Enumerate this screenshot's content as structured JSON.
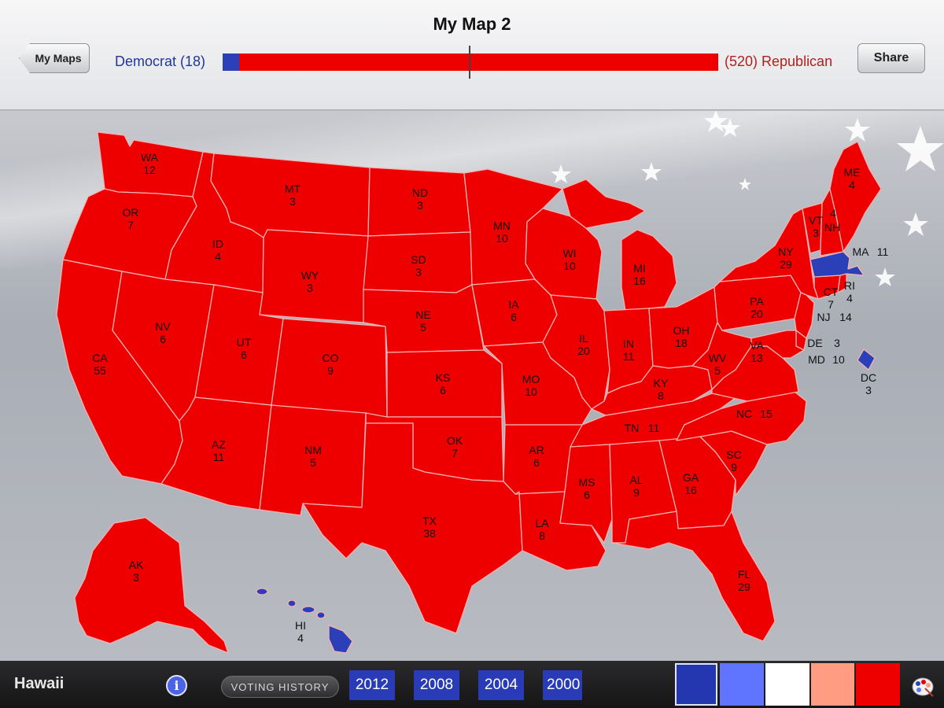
{
  "header": {
    "title": "My Map 2",
    "back_label": "My Maps",
    "share_label": "Share",
    "dem_label": "Democrat (18)",
    "rep_label": "(520) Republican",
    "dem_votes": 18,
    "rep_votes": 520
  },
  "colors": {
    "republican": "#ee0000",
    "democrat": "#2b3fb8",
    "map_border": "#f4b2b2"
  },
  "map": {
    "states": [
      {
        "abbr": "WA",
        "votes": "12"
      },
      {
        "abbr": "OR",
        "votes": "7"
      },
      {
        "abbr": "CA",
        "votes": "55"
      },
      {
        "abbr": "ID",
        "votes": "4"
      },
      {
        "abbr": "NV",
        "votes": "6"
      },
      {
        "abbr": "MT",
        "votes": "3"
      },
      {
        "abbr": "WY",
        "votes": "3"
      },
      {
        "abbr": "UT",
        "votes": "6"
      },
      {
        "abbr": "AZ",
        "votes": "11"
      },
      {
        "abbr": "CO",
        "votes": "9"
      },
      {
        "abbr": "NM",
        "votes": "5"
      },
      {
        "abbr": "ND",
        "votes": "3"
      },
      {
        "abbr": "SD",
        "votes": "3"
      },
      {
        "abbr": "NE",
        "votes": "5"
      },
      {
        "abbr": "KS",
        "votes": "6"
      },
      {
        "abbr": "OK",
        "votes": "7"
      },
      {
        "abbr": "TX",
        "votes": "38"
      },
      {
        "abbr": "MN",
        "votes": "10"
      },
      {
        "abbr": "IA",
        "votes": "6"
      },
      {
        "abbr": "MO",
        "votes": "10"
      },
      {
        "abbr": "AR",
        "votes": "6"
      },
      {
        "abbr": "LA",
        "votes": "8"
      },
      {
        "abbr": "WI",
        "votes": "10"
      },
      {
        "abbr": "IL",
        "votes": "20"
      },
      {
        "abbr": "MI",
        "votes": "16"
      },
      {
        "abbr": "IN",
        "votes": "11"
      },
      {
        "abbr": "OH",
        "votes": "18"
      },
      {
        "abbr": "KY",
        "votes": "8"
      },
      {
        "abbr": "TN",
        "votes": "11"
      },
      {
        "abbr": "MS",
        "votes": "6"
      },
      {
        "abbr": "AL",
        "votes": "9"
      },
      {
        "abbr": "GA",
        "votes": "16"
      },
      {
        "abbr": "FL",
        "votes": "29"
      },
      {
        "abbr": "SC",
        "votes": "9"
      },
      {
        "abbr": "NC",
        "votes": "15"
      },
      {
        "abbr": "VA",
        "votes": "13"
      },
      {
        "abbr": "WV",
        "votes": "5"
      },
      {
        "abbr": "PA",
        "votes": "20"
      },
      {
        "abbr": "NY",
        "votes": "29"
      },
      {
        "abbr": "VT",
        "votes": "3"
      },
      {
        "abbr": "NH",
        "votes": "4"
      },
      {
        "abbr": "ME",
        "votes": "4"
      },
      {
        "abbr": "MA",
        "votes": "11"
      },
      {
        "abbr": "RI",
        "votes": "4"
      },
      {
        "abbr": "CT",
        "votes": "7"
      },
      {
        "abbr": "NJ",
        "votes": "14"
      },
      {
        "abbr": "DE",
        "votes": "3"
      },
      {
        "abbr": "MD",
        "votes": "10"
      },
      {
        "abbr": "DC",
        "votes": "3"
      },
      {
        "abbr": "AK",
        "votes": "3"
      },
      {
        "abbr": "HI",
        "votes": "4"
      }
    ]
  },
  "bottom": {
    "selected_state": "Hawaii",
    "info_icon": "info-icon",
    "history_label": "VOTING HISTORY",
    "years": [
      "2012",
      "2008",
      "2004",
      "2000"
    ],
    "swatches": [
      {
        "name": "strong-democrat",
        "color": "#2437b0"
      },
      {
        "name": "lean-democrat",
        "color": "#5f74ff"
      },
      {
        "name": "undecided",
        "color": "#ffffff"
      },
      {
        "name": "lean-republican",
        "color": "#ff9c82"
      },
      {
        "name": "strong-republican",
        "color": "#ee0000"
      }
    ],
    "palette_icon": "palette-icon"
  }
}
